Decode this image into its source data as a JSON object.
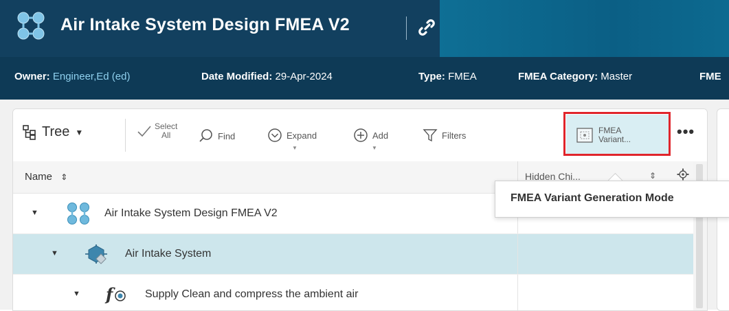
{
  "header": {
    "title": "Air Intake System Design FMEA V2",
    "owner_label": "Owner:",
    "owner_value": "Engineer,Ed (ed)",
    "date_label": "Date Modified:",
    "date_value": "29-Apr-2024",
    "type_label": "Type:",
    "type_value": "FMEA",
    "category_label": "FMEA Category:",
    "category_value": "Master",
    "truncated_label": "FME"
  },
  "toolbar": {
    "tree_label": "Tree",
    "select_all_line1": "Select",
    "select_all_line2": "All",
    "find_label": "Find",
    "expand_label": "Expand",
    "add_label": "Add",
    "filters_label": "Filters",
    "fmea_variant_line1": "FMEA",
    "fmea_variant_line2": "Variant...",
    "more_label": "•••"
  },
  "table": {
    "col_name": "Name",
    "col2_header": "Hidden Chi...",
    "rows": [
      {
        "label": "Air Intake System Design FMEA V2",
        "level": 0,
        "icon": "fmea-structure-icon"
      },
      {
        "label": "Air Intake System",
        "level": 1,
        "icon": "system-element-icon",
        "selected": true
      },
      {
        "label": "Supply Clean and compress the ambient air",
        "level": 2,
        "icon": "function-icon"
      }
    ]
  },
  "tooltip": {
    "text": "FMEA Variant Generation Mode"
  },
  "colors": {
    "header_bg": "#12405f",
    "info_bg": "#0e3a56",
    "selected_row": "#cde6ec",
    "highlight_border": "#e0242b"
  }
}
